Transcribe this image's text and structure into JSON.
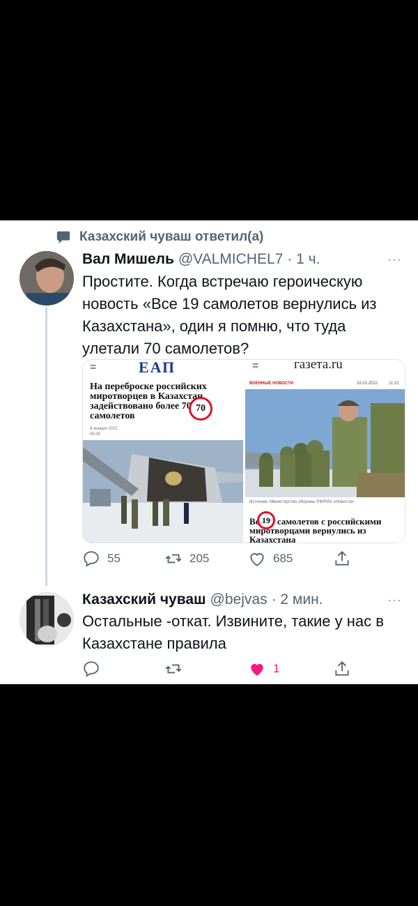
{
  "reply_context": {
    "text": "Казахский чуваш ответил(а)"
  },
  "tweet1": {
    "name": "Вал Мишель",
    "handle": "@VALMICHEL7",
    "time": "· 1 ч.",
    "text": "Простите. Когда встречаю героическую новость «Все 19 самолетов вернулись из Казахстана», один я помню, что туда улетали 70 самолетов?",
    "more": "···",
    "media": {
      "left": {
        "masthead": "ЕАП",
        "headline": "На переброске российских миротворцев в Казахстан задействовано более 70 самолетов",
        "highlight": "70",
        "date": "8 января 2022",
        "time": "06:05"
      },
      "right": {
        "masthead": "газета.ru",
        "section": "ВОЕННЫЕ НОВОСТИ",
        "date": "16.01.2022",
        "time": "11:22",
        "caption": "Источник: Министерство обороны РФ/РИА «Новости»",
        "headline": "Все 19 самолетов с российскими миротворцами вернулись из Казахстана",
        "highlight": "19"
      }
    },
    "actions": {
      "replies": "55",
      "retweets": "205",
      "likes": "685"
    }
  },
  "tweet2": {
    "name": "Казахский чуваш",
    "handle": "@bejvas",
    "time": "· 2 мин.",
    "text": "Остальные -откат. Извините, такие у нас в Казахстане правила",
    "more": "···",
    "actions": {
      "likes": "1"
    },
    "colors": {
      "like": "#f91880"
    }
  },
  "colors": {
    "secondary": "#536471",
    "highlight_ring": "#e0102a"
  }
}
